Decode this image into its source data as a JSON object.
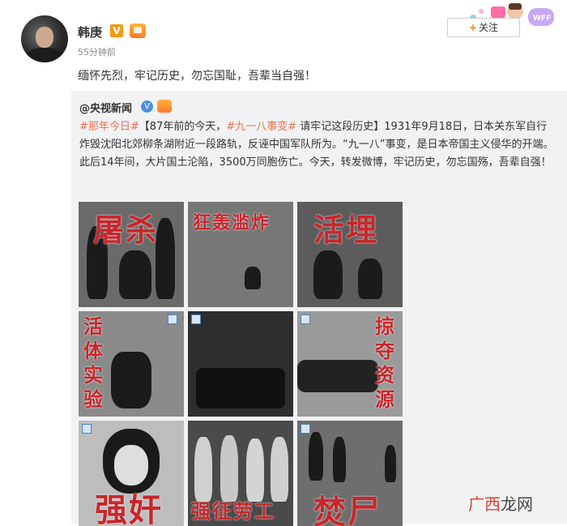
{
  "author": {
    "name": "韩庚",
    "verified_badge": "V",
    "timestamp": "55分钟前"
  },
  "follow_button": {
    "plus": "+",
    "label": "关注"
  },
  "post_text": "缅怀先烈，牢记历史，勿忘国耻，吾辈当自强！",
  "repost": {
    "author": "@央视新闻",
    "verified_badge": "V",
    "tag1": "#那年今日#",
    "bracket1": "【87年前的今天，",
    "tag2": "#九一八事变#",
    "body": " 请牢记这段历史】1931年9月18日，日本关东军自行炸毁沈阳北郊柳条湖附近一段路轨，反诬中国军队所为。“九一八”事变，是日本帝国主义侵华的开端。此后14年间，大片国土沦陷，3500万同胞伤亡。今天，转发微博，牢记历史，勿忘国殇，吾辈自强！"
  },
  "tiles": [
    {
      "title": "屠杀",
      "tone": "#6a6a6a"
    },
    {
      "title": "狂轰滥炸",
      "tone": "#777777"
    },
    {
      "title": "活埋",
      "tone": "#5c5c5c"
    },
    {
      "title": "活体实验",
      "tone": "#8a8a8a"
    },
    {
      "title": "",
      "tone": "#2e2e2e"
    },
    {
      "title": "掠夺资源",
      "tone": "#9a9a9a"
    },
    {
      "title": "强奸",
      "tone": "#bdbdbd"
    },
    {
      "title": "强征劳工",
      "tone": "#4a4a4a"
    },
    {
      "title": "焚尸",
      "tone": "#6e6e6e"
    }
  ],
  "watermark": {
    "part1": "广西",
    "part2": "龙网"
  },
  "colors": {
    "accent": "#eb7350",
    "title_red": "#c8262b",
    "follow_plus": "#ff8200"
  }
}
